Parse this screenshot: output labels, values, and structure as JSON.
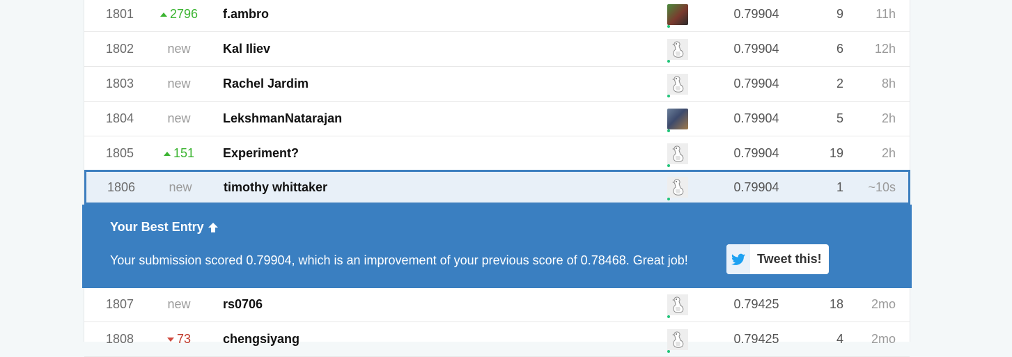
{
  "colors": {
    "accent": "#3a7fc1",
    "rank_up": "#3bb431",
    "rank_down": "#d04a3f",
    "online": "#22c47a"
  },
  "rows_top": [
    {
      "rank": "1801",
      "delta": "2796",
      "delta_dir": "up",
      "name": "f.ambro",
      "avatar": "photo",
      "score": "0.79904",
      "entries": "9",
      "last": "11h"
    },
    {
      "rank": "1802",
      "delta": "new",
      "delta_dir": "new",
      "name": "Kal Iliev",
      "avatar": "goose-icon",
      "score": "0.79904",
      "entries": "6",
      "last": "12h"
    },
    {
      "rank": "1803",
      "delta": "new",
      "delta_dir": "new",
      "name": "Rachel Jardim",
      "avatar": "goose-icon",
      "score": "0.79904",
      "entries": "2",
      "last": "8h"
    },
    {
      "rank": "1804",
      "delta": "new",
      "delta_dir": "new",
      "name": "LekshmanNatarajan",
      "avatar": "photo",
      "score": "0.79904",
      "entries": "5",
      "last": "2h"
    },
    {
      "rank": "1805",
      "delta": "151",
      "delta_dir": "up",
      "name": "Experiment?",
      "avatar": "goose-icon",
      "score": "0.79904",
      "entries": "19",
      "last": "2h"
    },
    {
      "rank": "1806",
      "delta": "new",
      "delta_dir": "new",
      "name": "timothy whittaker",
      "avatar": "goose-icon",
      "score": "0.79904",
      "entries": "1",
      "last": "~10s"
    }
  ],
  "banner": {
    "title": "Your Best Entry",
    "message": "Your submission scored 0.79904, which is an improvement of your previous score of 0.78468. Great job!",
    "tweet_label": "Tweet this!"
  },
  "rows_bottom": [
    {
      "rank": "1807",
      "delta": "new",
      "delta_dir": "new",
      "name": "rs0706",
      "avatar": "goose-icon",
      "score": "0.79425",
      "entries": "18",
      "last": "2mo"
    },
    {
      "rank": "1808",
      "delta": "73",
      "delta_dir": "down",
      "name": "chengsiyang",
      "avatar": "goose-icon",
      "score": "0.79425",
      "entries": "4",
      "last": "2mo"
    }
  ]
}
